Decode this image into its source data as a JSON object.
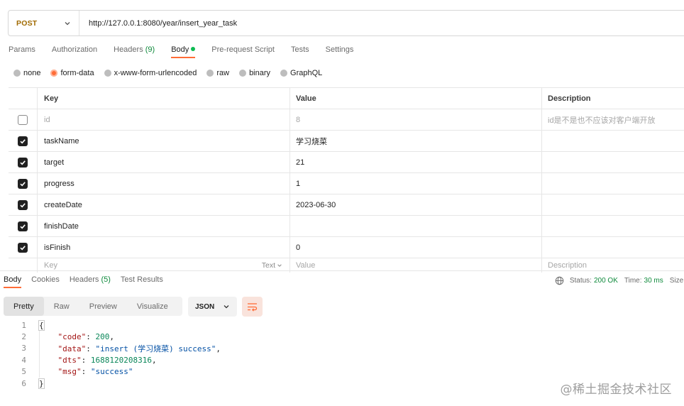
{
  "request": {
    "method": "POST",
    "url": "http://127.0.0.1:8080/year/insert_year_task"
  },
  "request_tabs": [
    {
      "label": "Params"
    },
    {
      "label": "Authorization"
    },
    {
      "label": "Headers",
      "count": "(9)"
    },
    {
      "label": "Body",
      "active": true
    },
    {
      "label": "Pre-request Script"
    },
    {
      "label": "Tests"
    },
    {
      "label": "Settings"
    }
  ],
  "body_types": [
    {
      "label": "none"
    },
    {
      "label": "form-data",
      "selected": true
    },
    {
      "label": "x-www-form-urlencoded"
    },
    {
      "label": "raw"
    },
    {
      "label": "binary"
    },
    {
      "label": "GraphQL"
    }
  ],
  "params_table": {
    "headers": {
      "key": "Key",
      "value": "Value",
      "description": "Description"
    },
    "rows": [
      {
        "checked": false,
        "key": "id",
        "value": "8",
        "description": "id是不是也不应该对客户端开放"
      },
      {
        "checked": true,
        "key": "taskName",
        "value": "学习烧菜",
        "description": ""
      },
      {
        "checked": true,
        "key": "target",
        "value": "21",
        "description": ""
      },
      {
        "checked": true,
        "key": "progress",
        "value": "1",
        "description": ""
      },
      {
        "checked": true,
        "key": "createDate",
        "value": "2023-06-30",
        "description": ""
      },
      {
        "checked": true,
        "key": "finishDate",
        "value": "",
        "description": ""
      },
      {
        "checked": true,
        "key": "isFinish",
        "value": "0",
        "description": ""
      }
    ],
    "placeholder": {
      "key": "Key",
      "type": "Text",
      "value": "Value",
      "description": "Description"
    }
  },
  "response_tabs": [
    {
      "label": "Body",
      "active": true
    },
    {
      "label": "Cookies"
    },
    {
      "label": "Headers",
      "count": "(5)"
    },
    {
      "label": "Test Results"
    }
  ],
  "response_status": {
    "status_label": "Status:",
    "status_value": "200 OK",
    "time_label": "Time:",
    "time_value": "30 ms",
    "size_label": "Size:"
  },
  "view_modes": [
    "Pretty",
    "Raw",
    "Preview",
    "Visualize"
  ],
  "format": "JSON",
  "response_lines": [
    {
      "num": "1",
      "text": "{"
    },
    {
      "num": "2",
      "key": "\"code\"",
      "value": "200",
      "type": "number",
      "tail": ","
    },
    {
      "num": "3",
      "key": "\"data\"",
      "value": "\"insert (学习烧菜) success\"",
      "type": "string",
      "tail": ","
    },
    {
      "num": "4",
      "key": "\"dts\"",
      "value": "1688120208316",
      "type": "number",
      "tail": ","
    },
    {
      "num": "5",
      "key": "\"msg\"",
      "value": "\"success\"",
      "type": "string",
      "tail": ""
    },
    {
      "num": "6",
      "text": "}"
    }
  ],
  "watermark": "@稀土掘金技术社区"
}
